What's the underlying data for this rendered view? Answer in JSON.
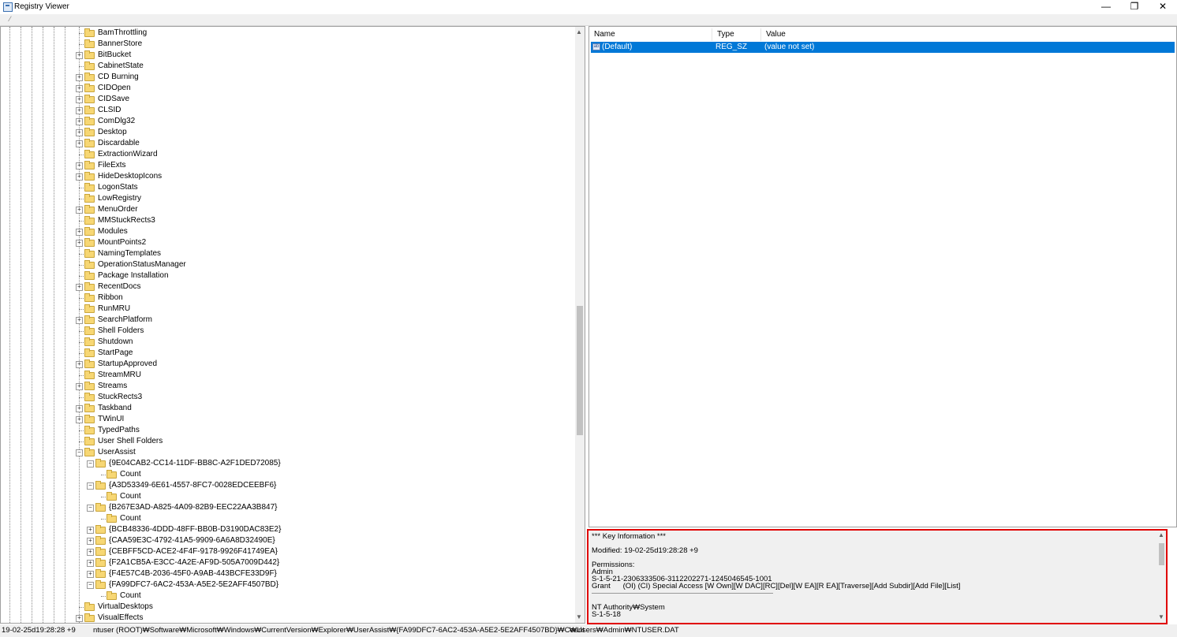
{
  "window": {
    "title": "Registry Viewer",
    "min": "—",
    "max": "❐",
    "close": "✕"
  },
  "tree": {
    "items": [
      {
        "label": "BamThrottling",
        "depth": 0,
        "toggle": ""
      },
      {
        "label": "BannerStore",
        "depth": 0,
        "toggle": ""
      },
      {
        "label": "BitBucket",
        "depth": 0,
        "toggle": "+"
      },
      {
        "label": "CabinetState",
        "depth": 0,
        "toggle": ""
      },
      {
        "label": "CD Burning",
        "depth": 0,
        "toggle": "+"
      },
      {
        "label": "CIDOpen",
        "depth": 0,
        "toggle": "+"
      },
      {
        "label": "CIDSave",
        "depth": 0,
        "toggle": "+"
      },
      {
        "label": "CLSID",
        "depth": 0,
        "toggle": "+"
      },
      {
        "label": "ComDlg32",
        "depth": 0,
        "toggle": "+"
      },
      {
        "label": "Desktop",
        "depth": 0,
        "toggle": "+"
      },
      {
        "label": "Discardable",
        "depth": 0,
        "toggle": "+"
      },
      {
        "label": "ExtractionWizard",
        "depth": 0,
        "toggle": ""
      },
      {
        "label": "FileExts",
        "depth": 0,
        "toggle": "+"
      },
      {
        "label": "HideDesktopIcons",
        "depth": 0,
        "toggle": "+"
      },
      {
        "label": "LogonStats",
        "depth": 0,
        "toggle": ""
      },
      {
        "label": "LowRegistry",
        "depth": 0,
        "toggle": ""
      },
      {
        "label": "MenuOrder",
        "depth": 0,
        "toggle": "+"
      },
      {
        "label": "MMStuckRects3",
        "depth": 0,
        "toggle": ""
      },
      {
        "label": "Modules",
        "depth": 0,
        "toggle": "+"
      },
      {
        "label": "MountPoints2",
        "depth": 0,
        "toggle": "+"
      },
      {
        "label": "NamingTemplates",
        "depth": 0,
        "toggle": ""
      },
      {
        "label": "OperationStatusManager",
        "depth": 0,
        "toggle": ""
      },
      {
        "label": "Package Installation",
        "depth": 0,
        "toggle": ""
      },
      {
        "label": "RecentDocs",
        "depth": 0,
        "toggle": "+"
      },
      {
        "label": "Ribbon",
        "depth": 0,
        "toggle": ""
      },
      {
        "label": "RunMRU",
        "depth": 0,
        "toggle": ""
      },
      {
        "label": "SearchPlatform",
        "depth": 0,
        "toggle": "+"
      },
      {
        "label": "Shell Folders",
        "depth": 0,
        "toggle": ""
      },
      {
        "label": "Shutdown",
        "depth": 0,
        "toggle": ""
      },
      {
        "label": "StartPage",
        "depth": 0,
        "toggle": ""
      },
      {
        "label": "StartupApproved",
        "depth": 0,
        "toggle": "+"
      },
      {
        "label": "StreamMRU",
        "depth": 0,
        "toggle": ""
      },
      {
        "label": "Streams",
        "depth": 0,
        "toggle": "+"
      },
      {
        "label": "StuckRects3",
        "depth": 0,
        "toggle": ""
      },
      {
        "label": "Taskband",
        "depth": 0,
        "toggle": "+"
      },
      {
        "label": "TWinUI",
        "depth": 0,
        "toggle": "+"
      },
      {
        "label": "TypedPaths",
        "depth": 0,
        "toggle": ""
      },
      {
        "label": "User Shell Folders",
        "depth": 0,
        "toggle": ""
      },
      {
        "label": "UserAssist",
        "depth": 0,
        "toggle": "-"
      },
      {
        "label": "{9E04CAB2-CC14-11DF-BB8C-A2F1DED72085}",
        "depth": 1,
        "toggle": "-"
      },
      {
        "label": "Count",
        "depth": 2,
        "toggle": ""
      },
      {
        "label": "{A3D53349-6E61-4557-8FC7-0028EDCEEBF6}",
        "depth": 1,
        "toggle": "-"
      },
      {
        "label": "Count",
        "depth": 2,
        "toggle": ""
      },
      {
        "label": "{B267E3AD-A825-4A09-82B9-EEC22AA3B847}",
        "depth": 1,
        "toggle": "-"
      },
      {
        "label": "Count",
        "depth": 2,
        "toggle": ""
      },
      {
        "label": "{BCB48336-4DDD-48FF-BB0B-D3190DAC83E2}",
        "depth": 1,
        "toggle": "+"
      },
      {
        "label": "{CAA59E3C-4792-41A5-9909-6A6A8D32490E}",
        "depth": 1,
        "toggle": "+"
      },
      {
        "label": "{CEBFF5CD-ACE2-4F4F-9178-9926F41749EA}",
        "depth": 1,
        "toggle": "+"
      },
      {
        "label": "{F2A1CB5A-E3CC-4A2E-AF9D-505A7009D442}",
        "depth": 1,
        "toggle": "+"
      },
      {
        "label": "{F4E57C4B-2036-45F0-A9AB-443BCFE33D9F}",
        "depth": 1,
        "toggle": "+"
      },
      {
        "label": "{FA99DFC7-6AC2-453A-A5E2-5E2AFF4507BD}",
        "depth": 1,
        "toggle": "-"
      },
      {
        "label": "Count",
        "depth": 2,
        "toggle": ""
      },
      {
        "label": "VirtualDesktops",
        "depth": 0,
        "toggle": ""
      },
      {
        "label": "VisualEffects",
        "depth": 0,
        "toggle": "+"
      }
    ]
  },
  "list": {
    "columns": [
      "Name",
      "Type",
      "Value"
    ],
    "rows": [
      {
        "name": "(Default)",
        "type": "REG_SZ",
        "value": "(value not set)",
        "icon": "ab"
      }
    ]
  },
  "info": {
    "header": "*** Key Information ***",
    "modified": "Modified: 19-02-25d19:28:28 +9",
    "permissions_label": "Permissions:",
    "owner1": "Admin",
    "sid1": "S-1-5-21-2306333506-3112202271-1245046545-1001",
    "grant1": "Grant      (OI) (CI) Special Access [W Own][W DAC][RC][Del][W EA][R EA][Traverse][Add Subdir][Add File][List]",
    "owner2": "NT Authority₩System",
    "sid2": "S-1-5-18"
  },
  "status": {
    "time": "19-02-25d19:28:28 +9",
    "path": "ntuser (ROOT)₩Software₩Microsoft₩Windows₩CurrentVersion₩Explorer₩UserAssist₩{FA99DFC7-6AC2-453A-A5E2-5E2AFF4507BD}₩Count",
    "file": "₩Users₩Admin₩NTUSER.DAT"
  }
}
